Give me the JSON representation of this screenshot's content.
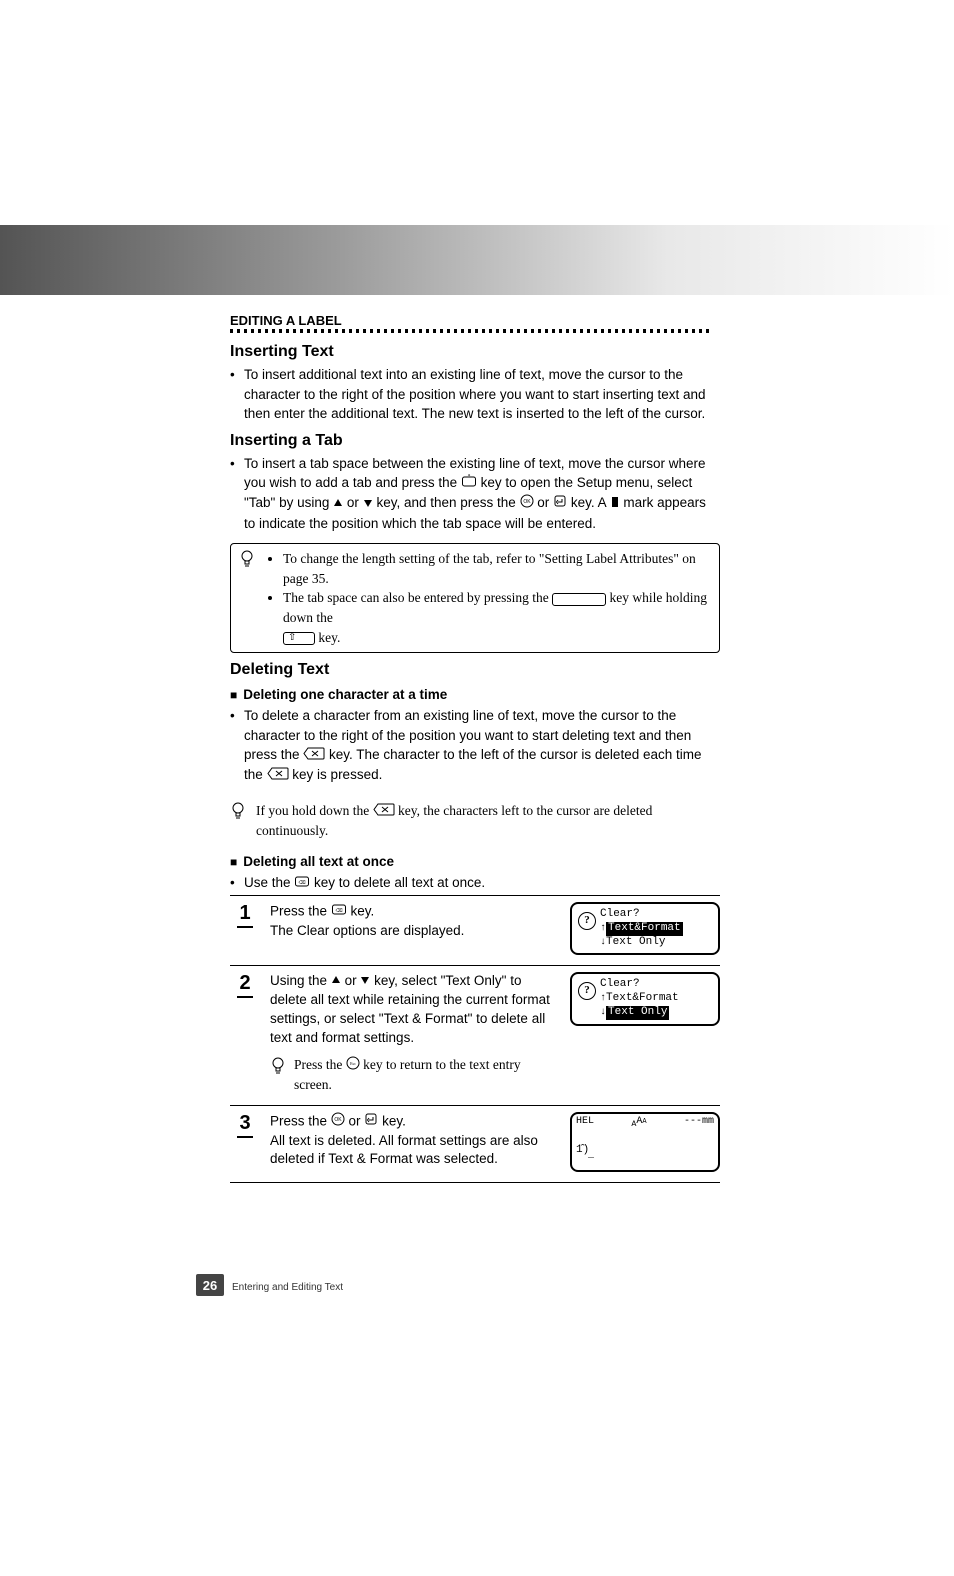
{
  "header": {
    "section_label": "EDITING A LABEL"
  },
  "sections": {
    "inserting_text": {
      "title": "Inserting Text",
      "bullet": "To insert additional text into an existing line of text, move the cursor to the character to the right of the position where you want to start inserting text and then enter the additional text. The new text is inserted to the left of the cursor."
    },
    "inserting_tab": {
      "title": "Inserting a Tab",
      "bullet_pre": "To insert a tab space between the existing line of text, move the cursor where you wish to add a tab and press the ",
      "bullet_mid1": " key to open the Setup menu, select \"Tab\" by using ",
      "bullet_mid2": " or ",
      "bullet_mid3": " key, and then press the ",
      "bullet_mid4": " or ",
      "bullet_mid5": " key. A ",
      "bullet_post": " mark appears to indicate the position which the tab space will be entered.",
      "note1": "To change the length setting of the tab, refer to \"Setting Label Attributes\" on page 35.",
      "note2_pre": "The tab space can also be entered by pressing the ",
      "note2_mid": " key while holding down the ",
      "note2_post": " key."
    },
    "deleting_text": {
      "title": "Deleting Text",
      "sub1_title": "Deleting one character at a time",
      "sub1_bullet_pre": "To delete a character from an existing line of text, move the cursor to the character to the right of the position you want to start deleting text and then press the ",
      "sub1_bullet_mid": " key. The character to the left of the cursor is deleted each time the ",
      "sub1_bullet_post": " key is pressed.",
      "sub1_note_pre": "If you hold down the ",
      "sub1_note_post": " key, the characters left to the cursor are deleted continuously.",
      "sub2_title": "Deleting all text at once",
      "sub2_bullet_pre": "Use the ",
      "sub2_bullet_post": " key to delete all text at once.",
      "steps": [
        {
          "num": "1",
          "line1_pre": "Press the ",
          "line1_post": " key.",
          "line2": "The Clear options are displayed.",
          "lcd_title": "Clear?",
          "lcd_opt1": "Text&Format",
          "lcd_opt2": "Text Only",
          "highlight": 0
        },
        {
          "num": "2",
          "body_pre": "Using the ",
          "body_mid": " or ",
          "body_post": " key, select \"Text Only\" to delete all text while retaining the current format settings, or select \"Text & Format\" to delete all text and format settings.",
          "lcd_title": "Clear?",
          "lcd_opt1": "Text&Format",
          "lcd_opt2": "Text Only",
          "highlight": 1,
          "subnote_pre": "Press the ",
          "subnote_post": " key to return to the text entry screen."
        },
        {
          "num": "3",
          "line1_pre": "Press the ",
          "line1_mid": " or ",
          "line1_post": " key.",
          "line2": "All text is deleted. All format settings are also deleted if Text & Format was selected.",
          "lcd_top_left": "HEL",
          "lcd_top_mid": "AAA",
          "lcd_top_right": "---mm"
        }
      ]
    }
  },
  "footer": {
    "page_number": "26",
    "running_title": "Entering and Editing Text"
  },
  "icons": {
    "setup_key": "setup-key-icon",
    "up": "up-triangle-icon",
    "down": "down-triangle-icon",
    "ok": "ok-key-icon",
    "enter": "enter-key-icon",
    "tab_mark": "tab-mark-icon",
    "backspace": "backspace-key-icon",
    "clear": "clear-key-icon",
    "esc": "esc-key-icon",
    "bulb": "lightbulb-icon",
    "blank_key": "blank-key-icon",
    "shift_key": "shift-key-icon"
  }
}
